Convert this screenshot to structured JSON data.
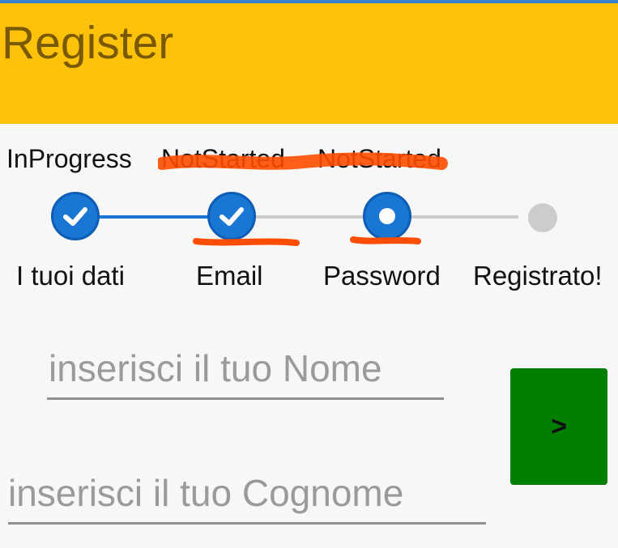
{
  "app": {
    "title": "Register"
  },
  "colors": {
    "appbar": "#ffc10a",
    "accent": "#1976d2",
    "inactive": "#cccccc",
    "button": "#007f00",
    "annotation": "#ff4d00"
  },
  "stepper": {
    "statuses": [
      "InProgress",
      "NotStarted",
      "NotStarted"
    ],
    "steps": [
      {
        "label": "I tuoi dati",
        "state": "done",
        "icon": "check-icon"
      },
      {
        "label": "Email",
        "state": "done",
        "icon": "check-icon"
      },
      {
        "label": "Password",
        "state": "current",
        "icon": "dot-icon"
      },
      {
        "label": "Registrato!",
        "state": "pending",
        "icon": "none"
      }
    ]
  },
  "form": {
    "first_name_placeholder": "inserisci il tuo Nome",
    "last_name_placeholder": "inserisci il tuo Cognome",
    "next_label": ">"
  }
}
